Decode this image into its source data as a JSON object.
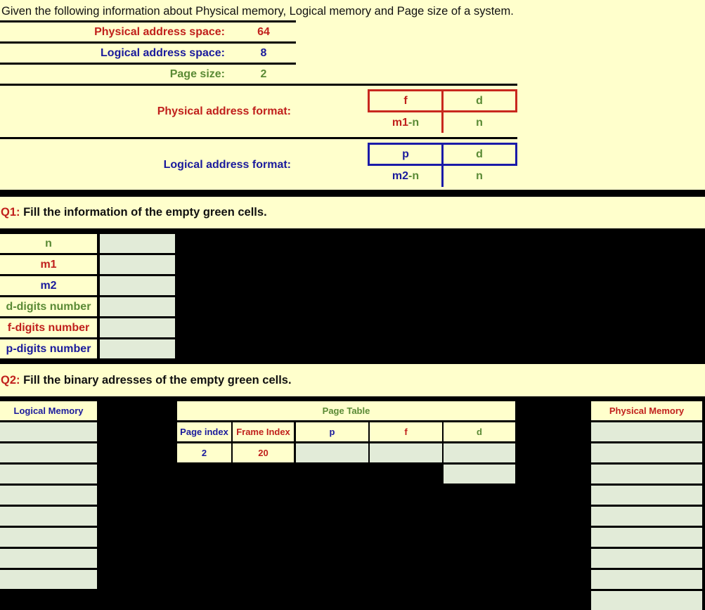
{
  "intro": "Given the following information about Physical memory, Logical memory and Page size of a system.",
  "given": {
    "physical_label": "Physical address space:",
    "physical_value": "64",
    "logical_label": "Logical address space:",
    "logical_value": "8",
    "page_size_label": "Page size:",
    "page_size_value": "2"
  },
  "formats": {
    "physical_label": "Physical address format:",
    "physical_top_left": "f",
    "physical_top_right": "d",
    "physical_bottom_left_a": "m1",
    "physical_bottom_left_b": "-n",
    "physical_bottom_right": "n",
    "logical_label": "Logical address format:",
    "logical_top_left": "p",
    "logical_top_right": "d",
    "logical_bottom_left_a": "m2",
    "logical_bottom_left_b": "-n",
    "logical_bottom_right": "n"
  },
  "q1": {
    "prefix": "Q1:",
    "text": " Fill the information of the empty green cells.",
    "rows": [
      {
        "label": "n",
        "color": "#5a8a35",
        "value": ""
      },
      {
        "label": "m1",
        "color": "#c0201c",
        "value": ""
      },
      {
        "label": "m2",
        "color": "#1a1a9c",
        "value": ""
      },
      {
        "label": "d-digits number",
        "color": "#5a8a35",
        "value": ""
      },
      {
        "label": "f-digits number",
        "color": "#c0201c",
        "value": ""
      },
      {
        "label": "p-digits number",
        "color": "#1a1a9c",
        "value": ""
      }
    ]
  },
  "q2": {
    "prefix": "Q2:",
    "text": " Fill the binary adresses of the empty green cells.",
    "logical_memory_title": "Logical Memory",
    "logical_memory_cells": [
      "",
      "",
      "",
      "",
      "",
      "",
      "",
      ""
    ],
    "page_table_title": "Page Table",
    "page_table_headers": [
      "Page index",
      "Frame Index",
      "p",
      "f",
      "d"
    ],
    "page_table_row": {
      "page_index": "2",
      "frame_index": "20",
      "p": "",
      "f": "",
      "d": "",
      "d2": ""
    },
    "physical_memory_title": "Physical Memory",
    "physical_memory_cells": [
      "",
      "",
      "",
      "",
      "",
      "",
      "",
      "",
      ""
    ]
  }
}
